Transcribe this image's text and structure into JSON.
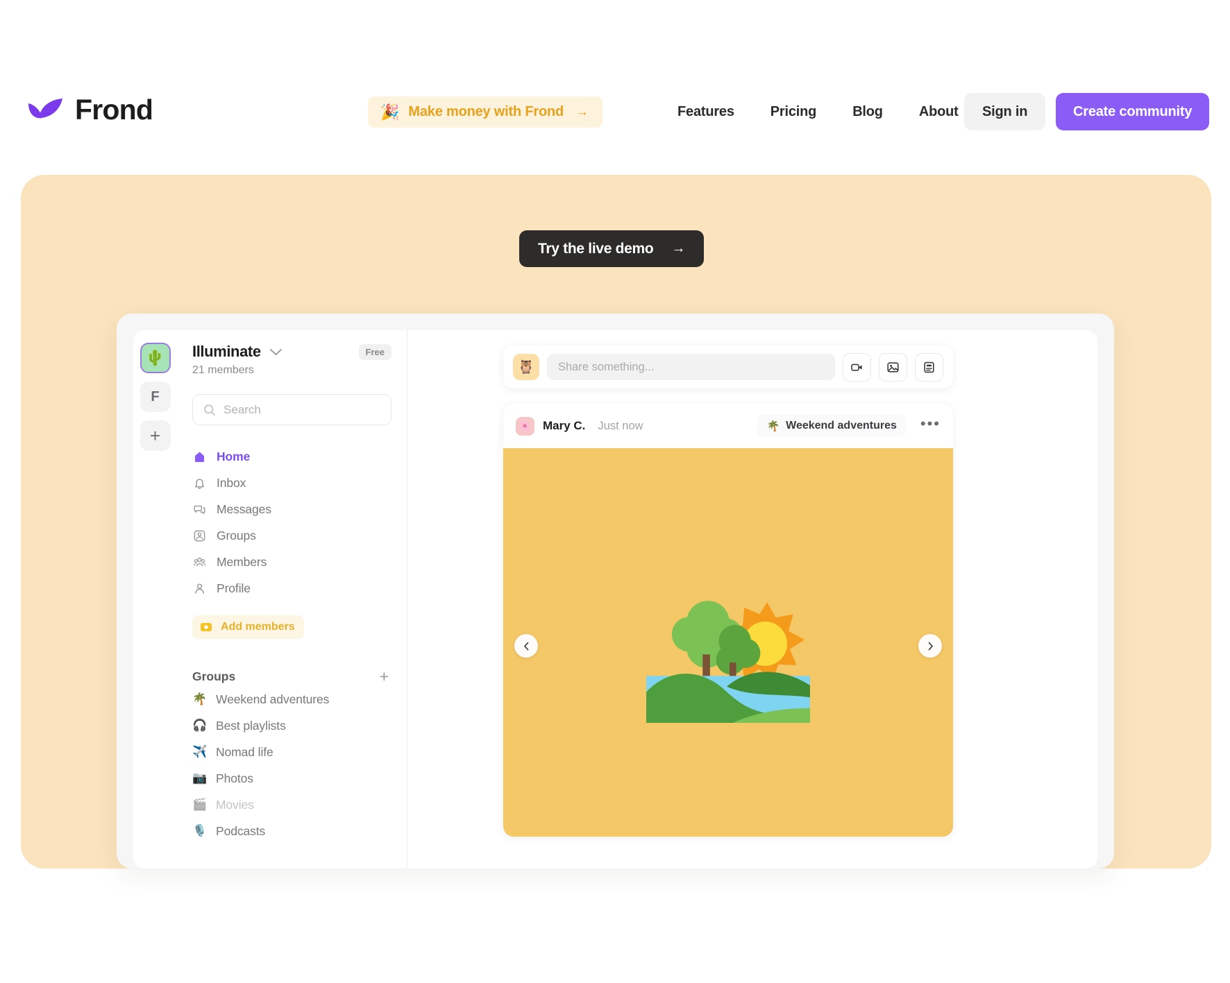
{
  "brand": {
    "name": "Frond",
    "logo_color": "#7C3AED"
  },
  "nav": {
    "promo": {
      "emoji": "🎉",
      "label": "Make money with Frond",
      "arrow": "→",
      "bg": "#FDF3DC",
      "color": "#E6A21C"
    },
    "links": [
      {
        "label": "Features"
      },
      {
        "label": "Pricing"
      },
      {
        "label": "Blog"
      },
      {
        "label": "About"
      }
    ],
    "sign_in": "Sign in",
    "create_community": "Create community",
    "create_community_color": "#8B5CF6"
  },
  "hero": {
    "bg": "#FAE3BD",
    "demo_button": {
      "label": "Try the live demo",
      "arrow": "→",
      "bg": "#2E2C2B"
    }
  },
  "app": {
    "rail": [
      {
        "name": "illuminate",
        "emoji": "🌵",
        "active": true
      },
      {
        "name": "frond",
        "letter": "F",
        "active": false
      },
      {
        "name": "add-workspace",
        "glyph": "+",
        "active": false
      }
    ],
    "workspace": {
      "title": "Illuminate",
      "members": "21 members",
      "plan_badge": "Free"
    },
    "search": {
      "placeholder": "Search"
    },
    "nav_items": [
      {
        "label": "Home",
        "icon": "home-icon",
        "active": true
      },
      {
        "label": "Inbox",
        "icon": "bell-icon",
        "active": false
      },
      {
        "label": "Messages",
        "icon": "messages-icon",
        "active": false
      },
      {
        "label": "Groups",
        "icon": "groups-icon",
        "active": false
      },
      {
        "label": "Members",
        "icon": "members-icon",
        "active": false
      },
      {
        "label": "Profile",
        "icon": "profile-icon",
        "active": false
      }
    ],
    "add_members": {
      "label": "Add members",
      "icon": "add-members-icon"
    },
    "groups_section": {
      "title": "Groups",
      "add_glyph": "+",
      "items": [
        {
          "emoji": "🌴",
          "label": "Weekend adventures",
          "dim": false
        },
        {
          "emoji": "🎧",
          "label": "Best playlists",
          "dim": false
        },
        {
          "emoji": "✈️",
          "label": "Nomad life",
          "dim": false
        },
        {
          "emoji": "📷",
          "label": "Photos",
          "dim": false
        },
        {
          "emoji": "🎬",
          "label": "Movies",
          "dim": true
        },
        {
          "emoji": "🎙️",
          "label": "Podcasts",
          "dim": false
        }
      ]
    },
    "composer": {
      "avatar_emoji": "🦉",
      "placeholder": "Share something...",
      "actions": [
        {
          "name": "video-icon"
        },
        {
          "name": "image-icon"
        },
        {
          "name": "poll-icon"
        }
      ]
    },
    "post": {
      "avatar_emoji": "🌸",
      "author": "Mary C.",
      "timestamp": "Just now",
      "group_emoji": "🌴",
      "group_label": "Weekend adventures",
      "more_glyph": "•••",
      "media_bg": "#F4C767",
      "media_alt": "national-park-illustration"
    }
  }
}
